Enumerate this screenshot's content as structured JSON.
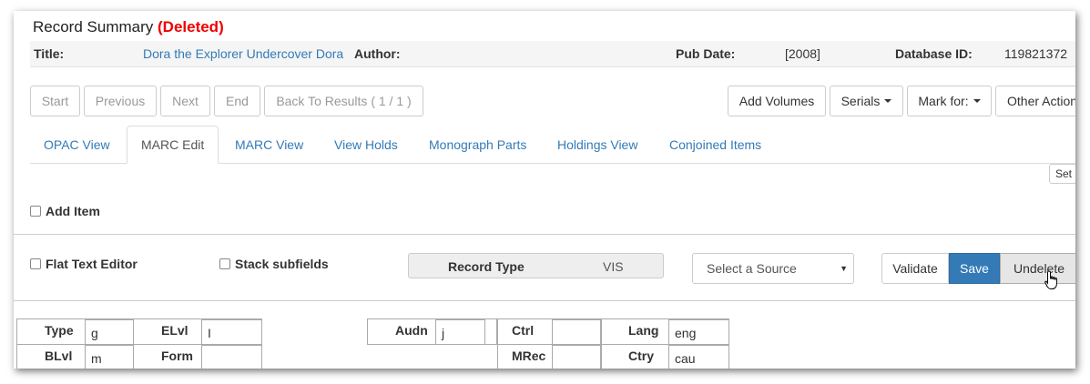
{
  "summary": {
    "heading": "Record Summary",
    "status": "(Deleted)",
    "title_label": "Title:",
    "title_value": "Dora the Explorer Undercover Dora",
    "author_label": "Author:",
    "pubdate_label": "Pub Date:",
    "pubdate_value": "[2008]",
    "dbid_label": "Database ID:",
    "dbid_value": "119821372"
  },
  "nav": {
    "start": "Start",
    "previous": "Previous",
    "next": "Next",
    "end": "End",
    "back": "Back To Results ( 1 / 1 )"
  },
  "actions": {
    "add_volumes": "Add Volumes",
    "serials": "Serials",
    "mark_for": "Mark for:",
    "other_actions": "Other Actions"
  },
  "tabs": [
    {
      "label": "OPAC View"
    },
    {
      "label": "MARC Edit"
    },
    {
      "label": "MARC View"
    },
    {
      "label": "View Holds"
    },
    {
      "label": "Monograph Parts"
    },
    {
      "label": "Holdings View"
    },
    {
      "label": "Conjoined Items"
    }
  ],
  "set_button": "Set",
  "add_item": "Add Item",
  "editor": {
    "flat_text": "Flat Text Editor",
    "stack_subfields": "Stack subfields",
    "record_type_label": "Record Type",
    "record_type_value": "VIS",
    "source_placeholder": "Select a Source",
    "validate": "Validate",
    "save": "Save",
    "undelete": "Undelete"
  },
  "fixed_fields": {
    "type_label": "Type",
    "type_value": "g",
    "elvl_label": "ELvl",
    "elvl_value": "I",
    "audn_label": "Audn",
    "audn_value": "j",
    "ctrl_label": "Ctrl",
    "ctrl_value": "",
    "lang_label": "Lang",
    "lang_value": "eng",
    "blvl_label": "BLvl",
    "blvl_value": "m",
    "form_label": "Form",
    "form_value": "",
    "mrec_label": "MRec",
    "mrec_value": "",
    "ctry_label": "Ctry",
    "ctry_value": "cau"
  },
  "colors": {
    "deleted": "#ee0000",
    "link": "#337ab7",
    "save_bg": "#337ab7"
  }
}
